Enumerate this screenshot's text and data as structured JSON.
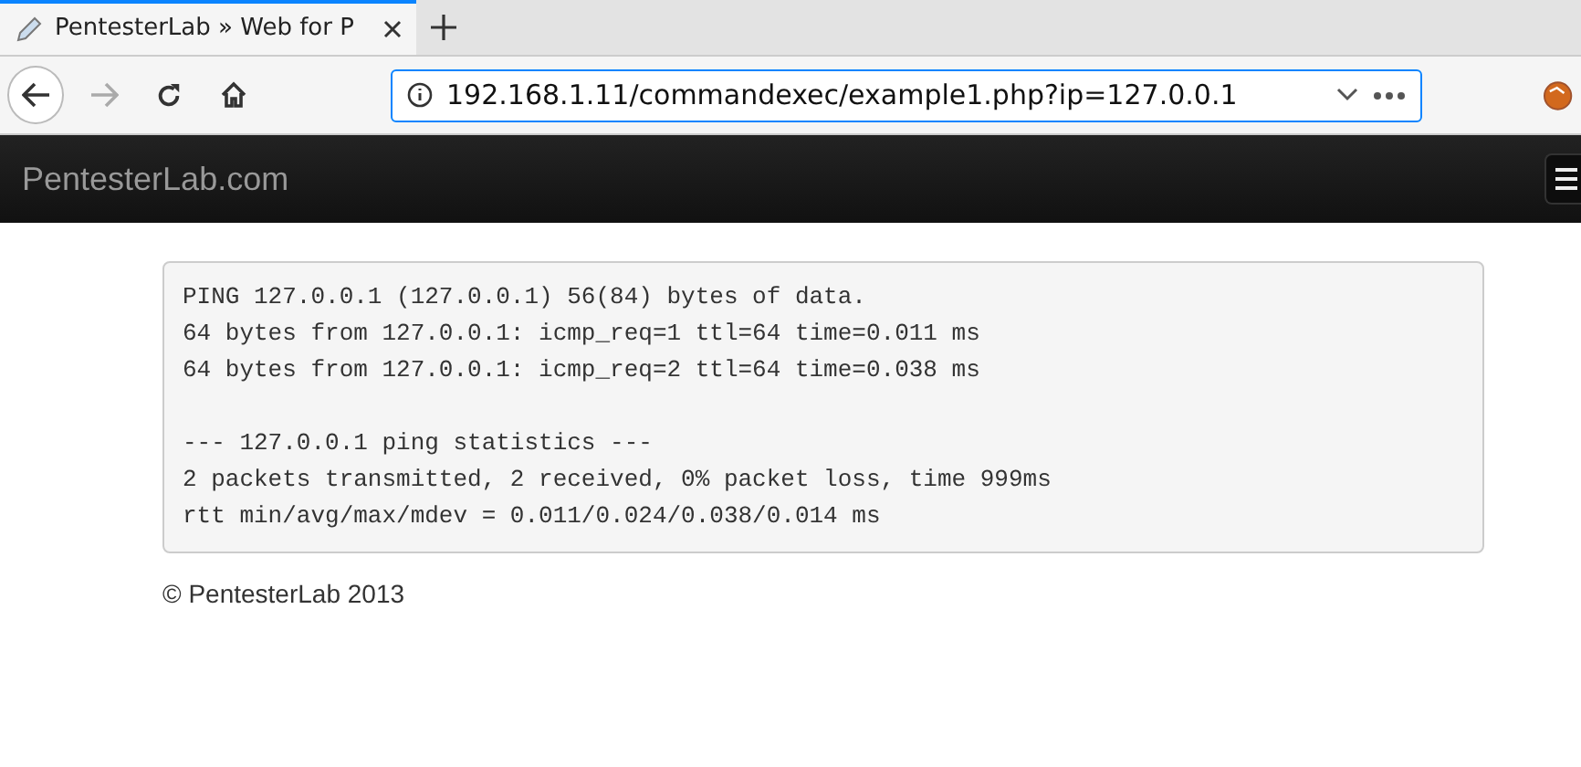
{
  "browser": {
    "tab": {
      "title": "PentesterLab » Web for P",
      "selected": true
    },
    "address": "192.168.1.11/commandexec/example1.php?ip=127.0.0.1"
  },
  "navbar": {
    "brand": "PentesterLab.com"
  },
  "output": {
    "blocks": [
      [
        "PING 127.0.0.1 (127.0.0.1) 56(84) bytes of data.",
        "64 bytes from 127.0.0.1: icmp_req=1 ttl=64 time=0.011 ms",
        "64 bytes from 127.0.0.1: icmp_req=2 ttl=64 time=0.038 ms"
      ],
      [
        "--- 127.0.0.1 ping statistics ---",
        "2 packets transmitted, 2 received, 0% packet loss, time 999ms",
        "rtt min/avg/max/mdev = 0.011/0.024/0.038/0.014 ms"
      ]
    ]
  },
  "footer": "© PentesterLab 2013"
}
